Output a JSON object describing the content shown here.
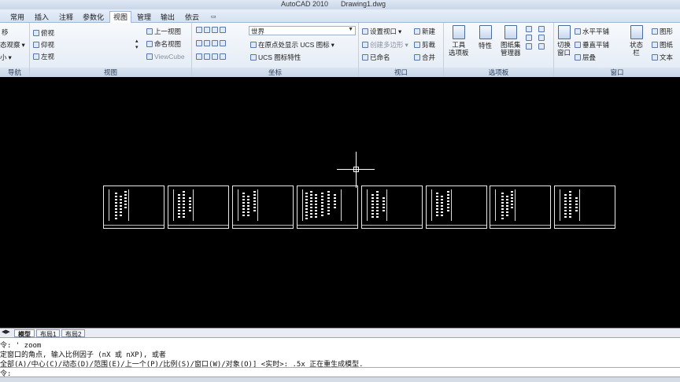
{
  "window": {
    "app": "AutoCAD 2010",
    "file": "Drawing1.dwg"
  },
  "tabs": [
    {
      "label": "常用"
    },
    {
      "label": "插入"
    },
    {
      "label": "注释"
    },
    {
      "label": "参数化"
    },
    {
      "label": "视图",
      "active": true
    },
    {
      "label": "管理"
    },
    {
      "label": "输出"
    },
    {
      "label": "依云"
    }
  ],
  "ribbon": {
    "nav": {
      "title": "导航",
      "items": [
        "移",
        "态观察",
        "小"
      ]
    },
    "views": {
      "title": "视图",
      "items": [
        "俯视",
        "仰视",
        "左视",
        "上一视图",
        "命名视图",
        "ViewCube"
      ]
    },
    "coords": {
      "title": "坐标",
      "ucs_combo": "世界",
      "origin": "在原点处显示 UCS 图标",
      "ucs_props": "UCS 图标特性"
    },
    "viewports": {
      "title": "视口",
      "set": "设置视口",
      "create": "创建多边形",
      "named": "已命名",
      "new": "新建",
      "clip": "剪裁",
      "join": "合并"
    },
    "palettes": {
      "title": "选项板",
      "tool": "工具\n选项板",
      "props": "特性",
      "sheetset": "图纸集\n管理器"
    },
    "window": {
      "title": "窗口",
      "switch": "切换\n窗口",
      "tile_h": "水平平铺",
      "tile_v": "垂直平铺",
      "cascade": "层叠",
      "status": "状态\n栏",
      "r1": "图形",
      "r2": "图纸",
      "r3": "文本"
    }
  },
  "layout_tabs": [
    {
      "label": "模型",
      "active": true
    },
    {
      "label": "布局1"
    },
    {
      "label": "布局2"
    }
  ],
  "command_lines": [
    "令: ' zoom",
    "定窗口的角点, 输入比例因子 (nX 或 nXP), 或者",
    "全部(A)/中心(C)/动态(D)/范围(E)/上一个(P)/比例(S)/窗口(W)/对象(O)] <实时>: .5x 正在重生成模型.",
    "令:"
  ],
  "colors": {
    "canvas": "#000000",
    "ribbon": "#e3ebf5",
    "accent": "#9fb6d4"
  }
}
